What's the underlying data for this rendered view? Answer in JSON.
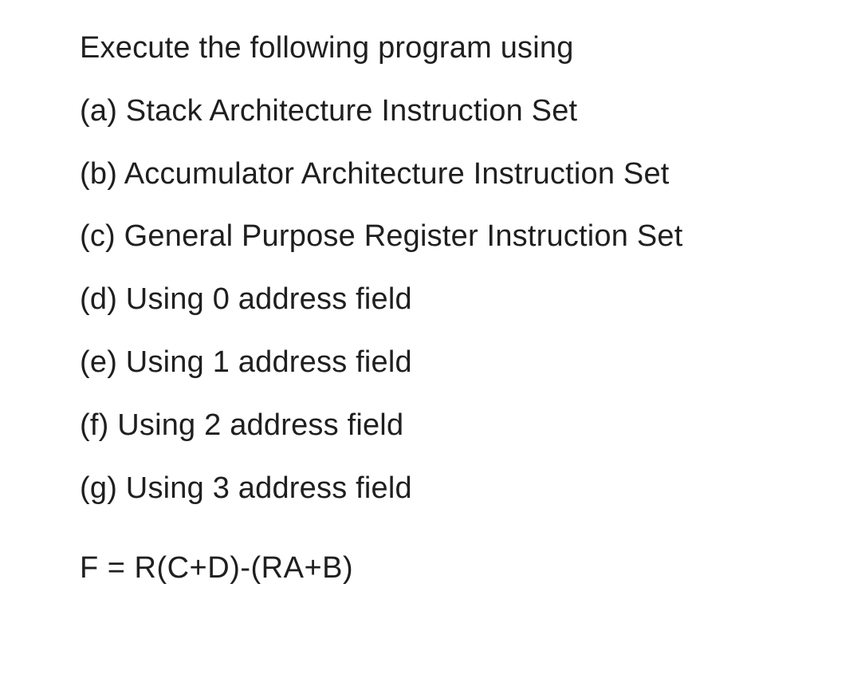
{
  "intro": "Execute the following program using",
  "items": [
    "(a) Stack Architecture Instruction Set",
    "(b) Accumulator Architecture Instruction Set",
    "(c) General Purpose Register Instruction Set",
    "(d) Using 0 address field",
    "(e) Using 1 address field",
    "(f) Using 2 address field",
    "(g) Using 3 address field"
  ],
  "formula": "F = R(C+D)-(RA+B)"
}
